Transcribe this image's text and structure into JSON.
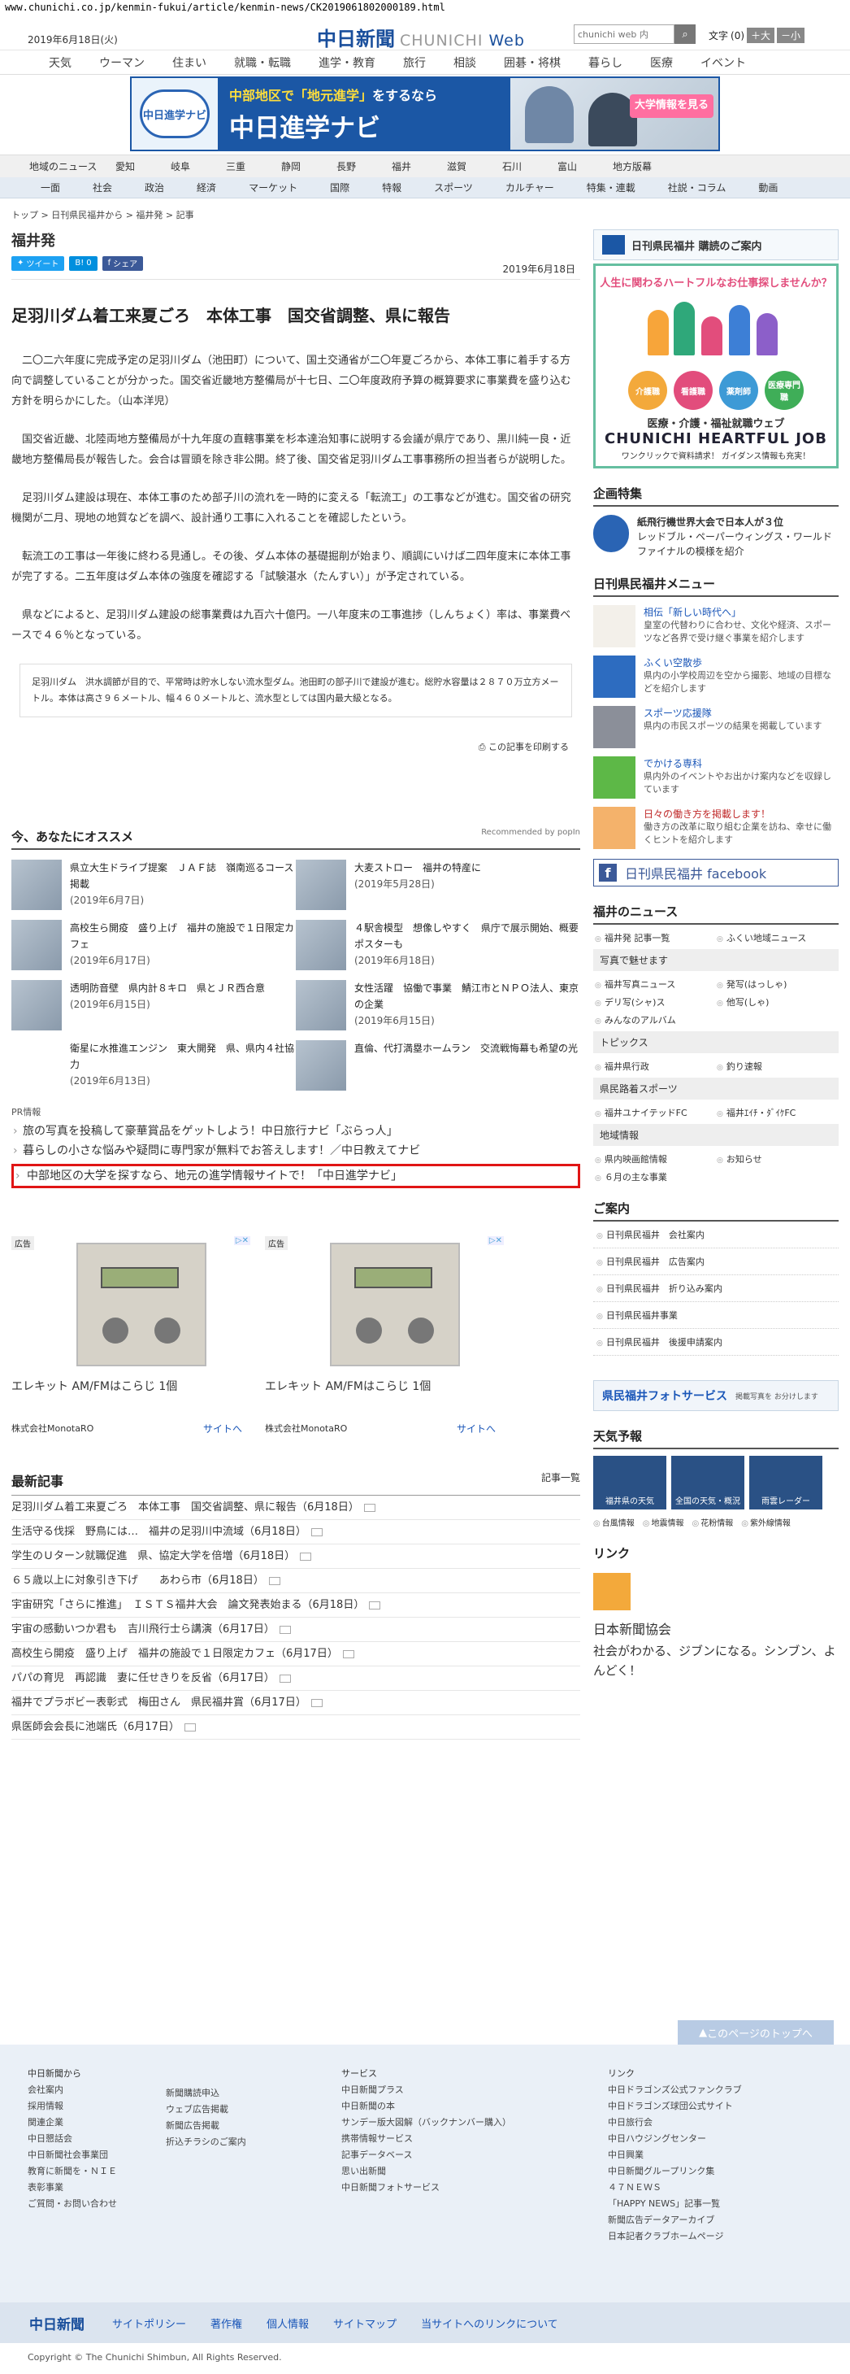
{
  "url": "www.chunichi.co.jp/kenmin-fukui/article/kenmin-news/CK2019061802000189.html",
  "header": {
    "date": "2019年6月18日(火)",
    "logo_jp": "中日新聞",
    "logo_en_a": "CHUNICHI",
    "logo_en_b": "Web",
    "search_placeholder": "chunichi web 内",
    "font_label": "文字",
    "font_value": "(0)",
    "font_big": "＋大",
    "font_small": "－小"
  },
  "topnav": [
    "天気",
    "ウーマン",
    "住まい",
    "就職・転職",
    "進学・教育",
    "旅行",
    "相談",
    "囲碁・将棋",
    "暮らし",
    "医療",
    "イベント"
  ],
  "banner": {
    "logo_text": "中日進学ナビ",
    "line1_a": "中部地区で",
    "line1_b": "「地元進学」",
    "line1_c": "をするなら",
    "line2": "中日進学ナビ",
    "tag": "大学情報を見る"
  },
  "regnav": [
    "地域のニュース",
    "愛知",
    "岐阜",
    "三重",
    "静岡",
    "長野",
    "福井",
    "滋賀",
    "石川",
    "富山",
    "地方版幕"
  ],
  "catnav": [
    "一面",
    "社会",
    "政治",
    "経済",
    "マーケット",
    "国際",
    "特報",
    "スポーツ",
    "カルチャー",
    "特集・連載",
    "社説・コラム",
    "動画"
  ],
  "breadcrumb": "トップ > 日刊県民福井から > 福井発 > 記事",
  "page_heading": "福井発",
  "share": {
    "tweet": "ツイート",
    "hatena": "0",
    "facebook": "シェア",
    "published": "2019年6月18日"
  },
  "article": {
    "title": "足羽川ダム着工来夏ごろ　本体工事　国交省調整、県に報告",
    "paragraphs": [
      "二〇二六年度に完成予定の足羽川ダム（池田町）について、国土交通省が二〇年夏ごろから、本体工事に着手する方向で調整していることが分かった。国交省近畿地方整備局が十七日、二〇年度政府予算の概算要求に事業費を盛り込む方針を明らかにした。（山本洋児）",
      "国交省近畿、北陸両地方整備局が十九年度の直轄事業を杉本達治知事に説明する会議が県庁であり、黒川純一良・近畿地方整備局長が報告した。会合は冒頭を除き非公開。終了後、国交省足羽川ダム工事事務所の担当者らが説明した。",
      "足羽川ダム建設は現在、本体工事のため部子川の流れを一時的に変える「転流工」の工事などが進む。国交省の研究機関が二月、現地の地質などを調べ、設計通り工事に入れることを確認したという。",
      "転流工の工事は一年後に終わる見通し。その後、ダム本体の基礎掘削が始まり、順調にいけば二四年度末に本体工事が完了する。二五年度はダム本体の強度を確認する「試験湛水（たんすい）」が予定されている。",
      "県などによると、足羽川ダム建設の総事業費は九百六十億円。一八年度末の工事進捗（しんちょく）率は、事業費ベースで４６％となっている。"
    ],
    "note": "足羽川ダム　洪水調節が目的で、平常時は貯水しない流水型ダム。池田町の部子川で建設が進む。総貯水容量は２８７０万立方メートル。本体は高さ９６メートル、幅４６０メートルと、流水型としては国内最大級となる。",
    "print": "この記事を印刷する"
  },
  "reco": {
    "heading": "今、あなたにオススメ",
    "provider": "Recommended by popIn",
    "items": [
      {
        "title": "県立大生ドライブ提案　ＪＡＦ誌　嶺南巡るコース掲載",
        "date": "(2019年6月7日)"
      },
      {
        "title": "大麦ストロー　福井の特産に",
        "date": "(2019年5月28日)"
      },
      {
        "title": "高校生ら開疫　盛り上げ　福井の施設で１日限定カフェ",
        "date": "(2019年6月17日)"
      },
      {
        "title": "４駅舎模型　想像しやすく　県庁で展示開始、概要ポスターも",
        "date": "(2019年6月18日)"
      },
      {
        "title": "透明防音壁　県内計８キロ　県とＪＲ西合意",
        "date": "(2019年6月15日)"
      },
      {
        "title": "女性活躍　協働で事業　鯖江市とＮＰＯ法人、東京の企業",
        "date": "(2019年6月15日)"
      },
      {
        "title": "衛星に水推進エンジン　東大開発　県、県内４社協力",
        "date": "(2019年6月13日)"
      },
      {
        "title": "直倫、代打満塁ホームラン　交流戦悔幕も希望の光",
        "date": ""
      }
    ],
    "pr_label": "PR情報",
    "pr_links": [
      "旅の写真を投稿して豪華賞品をゲットしよう！中日旅行ナビ「ぶらっ人」",
      "暮らしの小さな悩みや疑問に専門家が無料でお答えします！／中日教えてナビ",
      "中部地区の大学を探すなら、地元の進学情報サイトで！「中日進学ナビ」"
    ]
  },
  "ads": [
    {
      "label": "広告",
      "title": "エレキット AM/FMはこらじ 1個",
      "company": "株式会社MonotaRO",
      "more": "サイトへ"
    },
    {
      "label": "広告",
      "title": "エレキット AM/FMはこらじ 1個",
      "company": "株式会社MonotaRO",
      "more": "サイトへ"
    }
  ],
  "latest": {
    "heading": "最新記事",
    "more": "記事一覧",
    "items": [
      "足羽川ダム着工来夏ごろ　本体工事　国交省調整、県に報告（6月18日）",
      "生活守る伐採　野鳥には…　福井の足羽川中流域（6月18日）",
      "学生のＵターン就職促進　県、協定大学を倍増（6月18日）",
      "６５歳以上に対象引き下げ　　あわら市（6月18日）",
      "宇宙研究「さらに推進」　ＩＳＴＳ福井大会　論文発表始まる（6月18日）",
      "宇宙の感動いつか君も　吉川飛行士ら講演（6月17日）",
      "高校生ら開疫　盛り上げ　福井の施設で１日限定カフェ（6月17日）",
      "パパの育児　再認識　妻に任せきりを反省（6月17日）",
      "福井でプラボビー表彰式　梅田さん　県民福井賞（6月17日）",
      "県医師会会長に池端氏（6月17日）"
    ]
  },
  "side": {
    "kounyuu": "日刊県民福井 購読のご案内",
    "heart": {
      "top": "人生に関わるハートフルなお仕事探しませんか？",
      "circles": [
        "介護職",
        "看護職",
        "薬剤師",
        "医療専門職"
      ],
      "w1": "医療・介護・福祉就職ウェブ",
      "w2": "CHUNICHI HEARTFUL JOB",
      "w3": "ワンクリックで資料請求！ ガイダンス情報も充実！"
    },
    "kikaku": {
      "heading": "企画特集",
      "title": "紙飛行機世界大会で日本人が３位",
      "text": "レッドブル・ペーパーウィングス・ワールドファイナルの模様を紹介"
    },
    "menu": {
      "heading": "日刊県民福井メニュー",
      "items": [
        {
          "title": "相伝「新しい時代へ」",
          "text": "皇室の代替わりに合わせ、文化や経済、スポーツなど各界で受け継ぐ事業を紹介します"
        },
        {
          "title": "ふくい空散歩",
          "text": "県内の小学校周辺を空から撮影、地域の目標などを紹介します"
        },
        {
          "title": "スポーツ応援隊",
          "text": "県内の市民スポーツの結果を掲載しています"
        },
        {
          "title": "でかける専科",
          "text": "県内外のイベントやお出かけ案内などを収録しています"
        },
        {
          "title": "日々の働き方を掲載します！",
          "text": "働き方の改革に取り組む企業を訪ね、幸せに働くヒントを紹介します"
        }
      ]
    },
    "facebook": "日刊県民福井 facebook",
    "fukui_news": {
      "heading": "福井のニュース",
      "row1": [
        "福井発 記事一覧",
        "ふくい地域ニュース"
      ],
      "sub1": "写真で魅せます",
      "row2": [
        "福井写真ニュース",
        "発写(はっしゃ)",
        "デリ写(シャ)ス",
        "他写(しゃ)",
        "みんなのアルバム"
      ],
      "sub2": "トピックス",
      "row3": [
        "福井県行政",
        "釣り速報"
      ],
      "sub3": "県民路着スポーツ",
      "row4": [
        "福井ユナイテッドFC",
        "福井ｴｲﾁ・ﾀﾞｲｹFC"
      ],
      "sub4": "地域情報",
      "row5": [
        "県内映画館情報",
        "お知らせ",
        "６月の主な事業"
      ]
    },
    "guide": {
      "heading": "ご案内",
      "items": [
        "日刊県民福井　会社案内",
        "日刊県民福井　広告案内",
        "日刊県民福井　折り込み案内",
        "日刊県民福井事業",
        "日刊県民福井　後援申請案内"
      ]
    },
    "photo_service": "県民福井フォトサービス",
    "photo_service_note": "掲載写真を お分けします",
    "weather": {
      "heading": "天気予報",
      "cells": [
        "福井県の天気",
        "全国の天気・概況",
        "雨雲レーダー"
      ],
      "links": [
        "台風情報",
        "地震情報",
        "花粉情報",
        "紫外線情報"
      ]
    },
    "link": {
      "heading": "リンク",
      "name": "日本新聞協会",
      "copy": "社会がわかる、ジブンになる。シンブン、よんどく！"
    }
  },
  "totop": "このページのトップへ",
  "footer": {
    "col1_head": "中日新聞から",
    "col1": [
      "会社案内",
      "採用情報",
      "関連企業",
      "中日懇話会",
      "中日新聞社会事業団",
      "教育に新聞を・ＮＩＥ",
      "表彰事業",
      "ご質問・お問い合わせ"
    ],
    "col2": [
      "新聞購読申込",
      "ウェブ広告掲載",
      "新聞広告掲載",
      "折込チラシのご案内"
    ],
    "col3_head": "サービス",
    "col3": [
      "中日新聞プラス",
      "中日新聞の本",
      "サンデー版大図解（バックナンバー購入）",
      "携帯情報サービス",
      "記事データベース",
      "思い出新聞",
      "中日新聞フォトサービス"
    ],
    "col4_head": "リンク",
    "col4": [
      "中日ドラゴンズ公式ファンクラブ",
      "中日ドラゴンズ球団公式サイト",
      "中日旅行会",
      "中日ハウジングセンター",
      "中日興業",
      "中日新聞グループリンク集",
      "４７ＮＥＷＳ",
      "「HAPPY NEWS」記事一覧",
      "新聞広告データアーカイブ",
      "日本記者クラブホームページ"
    ],
    "bottom_logo": "中日新聞",
    "bottom_links": [
      "サイトポリシー",
      "著作権",
      "個人情報",
      "サイトマップ",
      "当サイトへのリンクについて"
    ],
    "copyright": "Copyright © The Chunichi Shimbun, All Rights Reserved."
  }
}
